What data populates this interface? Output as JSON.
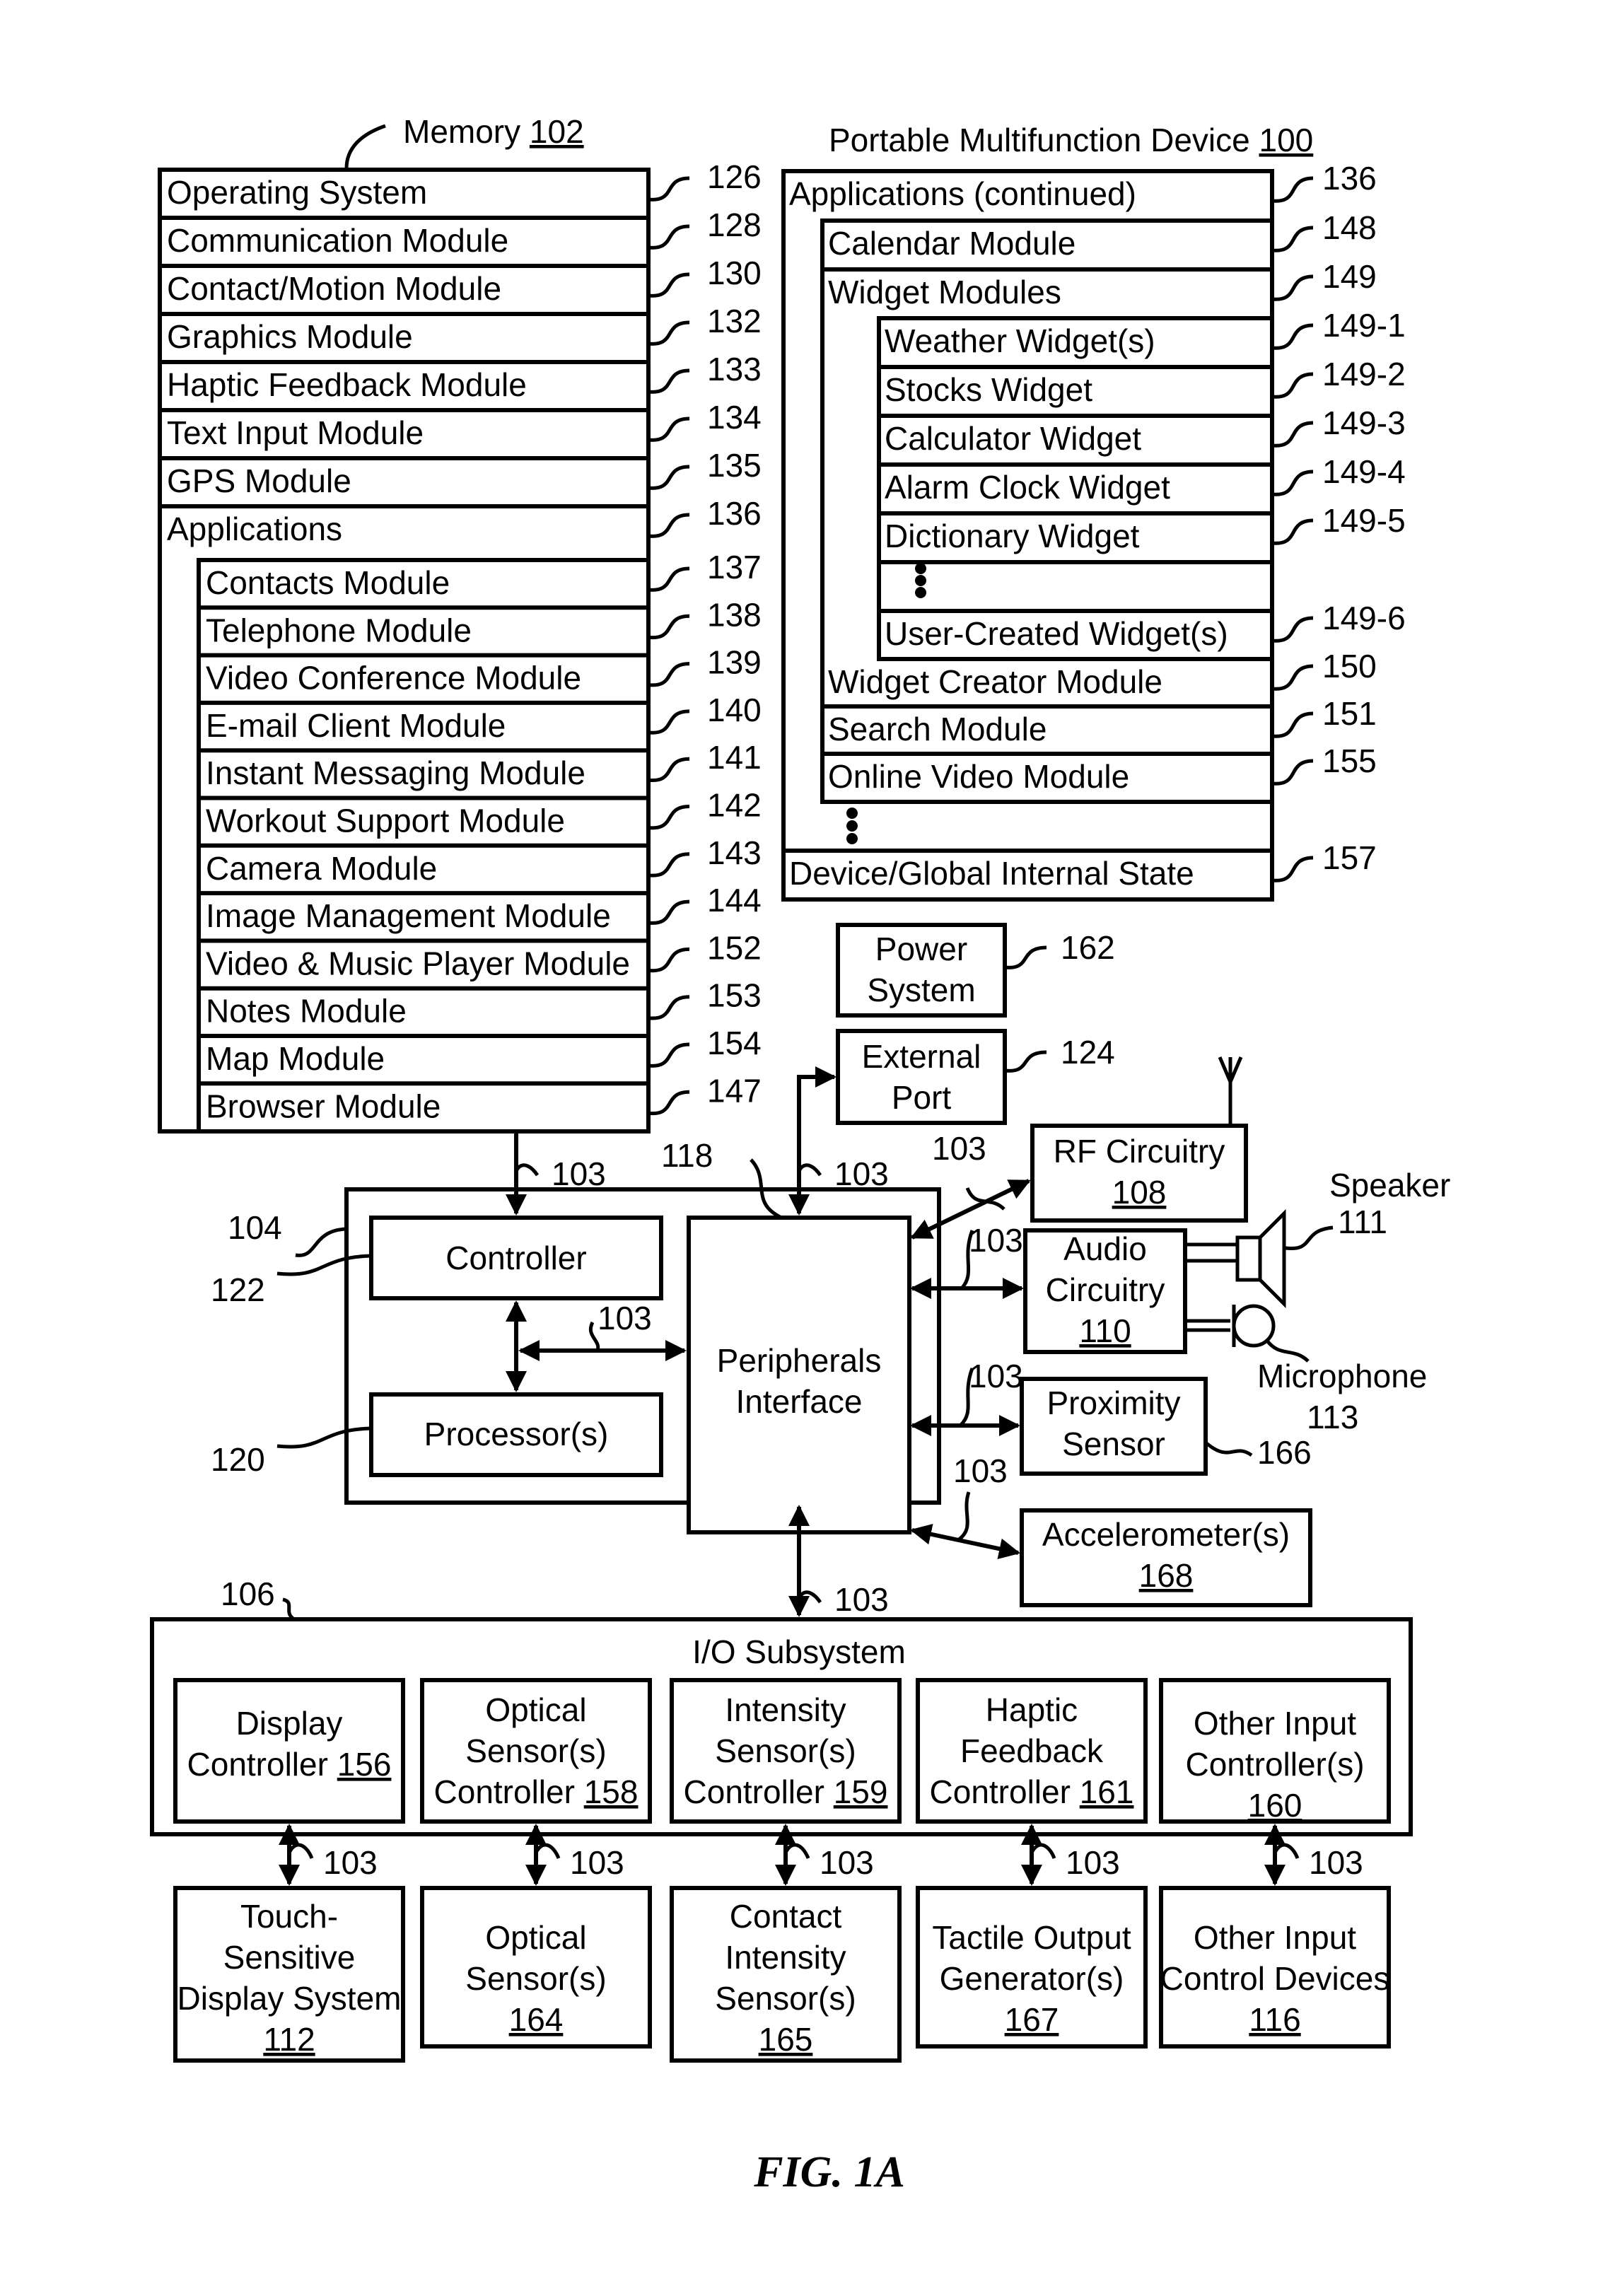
{
  "memory": {
    "title": "Memory ",
    "ref": "102",
    "rows": [
      {
        "label": "Operating System",
        "ref": "126"
      },
      {
        "label": "Communication Module",
        "ref": "128"
      },
      {
        "label": "Contact/Motion Module",
        "ref": "130"
      },
      {
        "label": "Graphics Module",
        "ref": "132"
      },
      {
        "label": "Haptic Feedback Module",
        "ref": "133"
      },
      {
        "label": "Text Input Module",
        "ref": "134"
      },
      {
        "label": "GPS Module",
        "ref": "135"
      },
      {
        "label": "Applications",
        "ref": "136"
      }
    ],
    "apps": [
      {
        "label": "Contacts Module",
        "ref": "137"
      },
      {
        "label": "Telephone Module",
        "ref": "138"
      },
      {
        "label": "Video Conference Module",
        "ref": "139"
      },
      {
        "label": "E-mail Client Module",
        "ref": "140"
      },
      {
        "label": "Instant Messaging Module",
        "ref": "141"
      },
      {
        "label": "Workout Support Module",
        "ref": "142"
      },
      {
        "label": "Camera Module",
        "ref": "143"
      },
      {
        "label": "Image Management Module",
        "ref": "144"
      },
      {
        "label": "Video & Music Player Module",
        "ref": "152"
      },
      {
        "label": "Notes Module",
        "ref": "153"
      },
      {
        "label": "Map Module",
        "ref": "154"
      },
      {
        "label": "Browser Module",
        "ref": "147"
      }
    ]
  },
  "device": {
    "title": "Portable Multifunction Device ",
    "ref": "100",
    "apps_continued": {
      "label": "Applications (continued)",
      "ref": "136"
    },
    "calendar": {
      "label": "Calendar Module",
      "ref": "148"
    },
    "widgets": {
      "label": "Widget Modules",
      "ref": "149"
    },
    "widget_items": [
      {
        "label": "Weather Widget(s)",
        "ref": "149-1"
      },
      {
        "label": "Stocks Widget",
        "ref": "149-2"
      },
      {
        "label": "Calculator Widget",
        "ref": "149-3"
      },
      {
        "label": "Alarm Clock Widget",
        "ref": "149-4"
      },
      {
        "label": "Dictionary Widget",
        "ref": "149-5"
      },
      {
        "label": "",
        "ref": ""
      },
      {
        "label": "User-Created Widget(s)",
        "ref": "149-6"
      }
    ],
    "after_widgets": [
      {
        "label": "Widget Creator Module",
        "ref": "150"
      },
      {
        "label": "Search Module",
        "ref": "151"
      },
      {
        "label": "Online Video Module",
        "ref": "155"
      }
    ],
    "state": {
      "label": "Device/Global Internal State",
      "ref": "157"
    }
  },
  "power": {
    "line1": "Power",
    "line2": "System",
    "ref": "162"
  },
  "external_port": {
    "line1": "External",
    "line2": "Port",
    "ref": "124"
  },
  "chip": {
    "ref": "104",
    "controller": {
      "label": "Controller",
      "ref": "122"
    },
    "processor": {
      "label": "Processor(s)",
      "ref": "120"
    },
    "peripherals": {
      "line1": "Peripherals",
      "line2": "Interface",
      "ref": "118"
    }
  },
  "bus_ref": "103",
  "rf": {
    "line1": "RF Circuitry",
    "num": "108"
  },
  "audio": {
    "line1": "Audio",
    "line2": "Circuitry",
    "num": "110"
  },
  "speaker": {
    "label": "Speaker",
    "ref": "111"
  },
  "microphone": {
    "label": "Microphone",
    "ref": "113"
  },
  "proximity": {
    "line1": "Proximity",
    "line2": "Sensor",
    "ref": "166"
  },
  "accelerometer": {
    "line1": "Accelerometer(s)",
    "num": "168"
  },
  "io": {
    "title": "I/O Subsystem",
    "ref": "106",
    "controllers": [
      {
        "lines": [
          "Display",
          "Controller "
        ],
        "num": "156"
      },
      {
        "lines": [
          "Optical",
          "Sensor(s)",
          "Controller "
        ],
        "num": "158"
      },
      {
        "lines": [
          "Intensity",
          "Sensor(s)",
          "Controller "
        ],
        "num": "159"
      },
      {
        "lines": [
          "Haptic",
          "Feedback",
          "Controller "
        ],
        "num": "161"
      },
      {
        "lines": [
          "Other Input",
          "Controller(s)"
        ],
        "num": "160"
      }
    ],
    "devices": [
      {
        "lines": [
          "Touch-",
          "Sensitive",
          "Display System"
        ],
        "num": "112"
      },
      {
        "lines": [
          "Optical",
          "Sensor(s)"
        ],
        "num": "164"
      },
      {
        "lines": [
          "Contact",
          "Intensity",
          "Sensor(s)"
        ],
        "num": "165"
      },
      {
        "lines": [
          "Tactile Output",
          "Generator(s)"
        ],
        "num": "167"
      },
      {
        "lines": [
          "Other Input",
          "Control Devices"
        ],
        "num": "116"
      }
    ]
  },
  "figure_caption": "FIG. 1A"
}
